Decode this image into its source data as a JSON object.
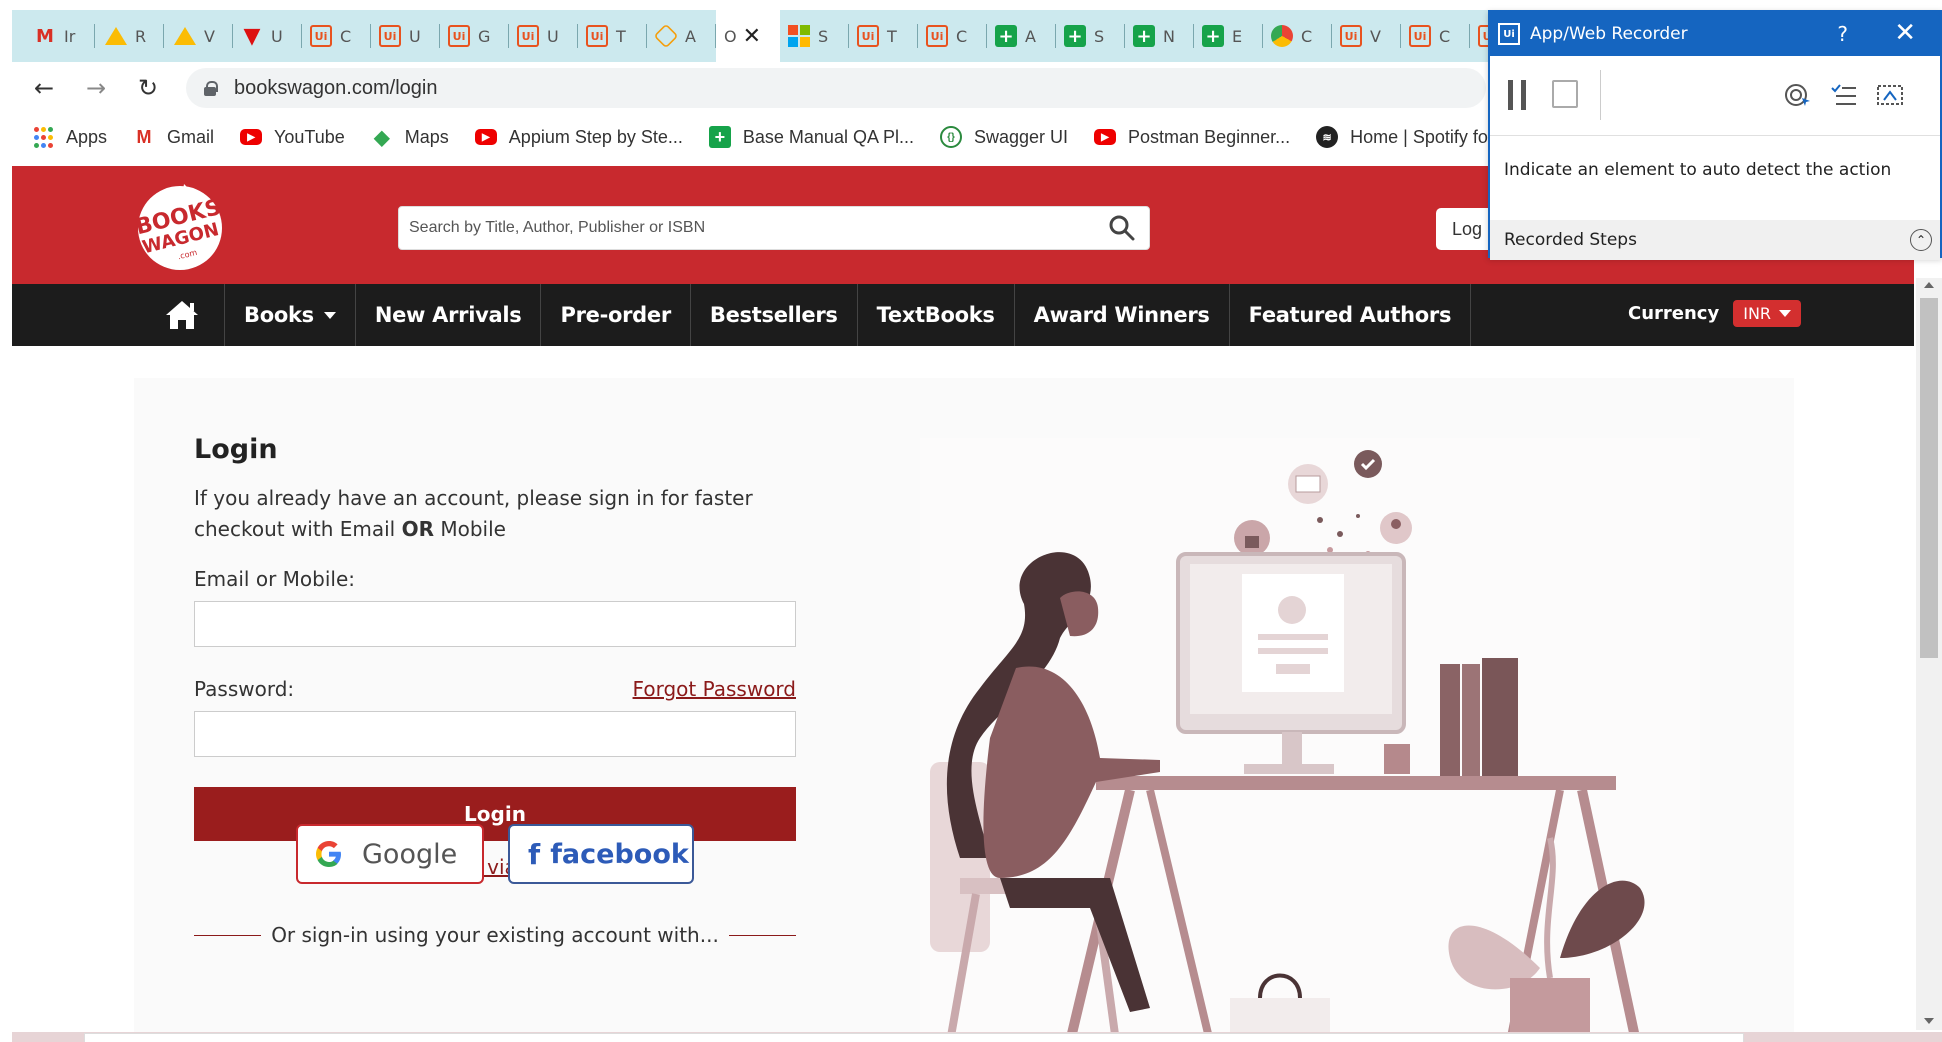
{
  "browser": {
    "tabs": [
      {
        "icon": "gmail-icon",
        "label": "Ir"
      },
      {
        "icon": "google-drive-icon",
        "label": "R"
      },
      {
        "icon": "google-drive-icon",
        "label": "V"
      },
      {
        "icon": "red-v-icon",
        "label": "U"
      },
      {
        "icon": "uipath-icon",
        "label": "C"
      },
      {
        "icon": "uipath-icon",
        "label": "U"
      },
      {
        "icon": "uipath-icon",
        "label": "G"
      },
      {
        "icon": "uipath-icon",
        "label": "U"
      },
      {
        "icon": "uipath-icon",
        "label": "T"
      },
      {
        "icon": "orange-hex-icon",
        "label": "A"
      },
      {
        "icon": "",
        "label": "O",
        "active": true
      },
      {
        "icon": "microsoft-icon",
        "label": "S"
      },
      {
        "icon": "uipath-icon",
        "label": "T"
      },
      {
        "icon": "uipath-icon",
        "label": "C"
      },
      {
        "icon": "google-sheets-icon",
        "label": "A"
      },
      {
        "icon": "google-sheets-icon",
        "label": "S"
      },
      {
        "icon": "google-sheets-icon",
        "label": "N"
      },
      {
        "icon": "google-sheets-icon",
        "label": "E"
      },
      {
        "icon": "chrome-icon",
        "label": "C"
      },
      {
        "icon": "uipath-icon",
        "label": "V"
      },
      {
        "icon": "uipath-icon",
        "label": "C"
      },
      {
        "icon": "uipath-icon",
        "label": ""
      }
    ],
    "url": "bookswagon.com/login",
    "bookmarks": [
      {
        "icon": "apps-icon",
        "label": "Apps"
      },
      {
        "icon": "gmail-icon",
        "label": "Gmail"
      },
      {
        "icon": "youtube-icon",
        "label": "YouTube"
      },
      {
        "icon": "maps-icon",
        "label": "Maps"
      },
      {
        "icon": "youtube-icon",
        "label": "Appium Step by Ste..."
      },
      {
        "icon": "google-sheets-icon",
        "label": "Base Manual QA Pl..."
      },
      {
        "icon": "swagger-icon",
        "label": "Swagger UI"
      },
      {
        "icon": "youtube-icon",
        "label": "Postman Beginner..."
      },
      {
        "icon": "spotify-icon",
        "label": "Home | Spotify for..."
      }
    ]
  },
  "site": {
    "logo_text_1": "BOOKS",
    "logo_text_2": "WAGON",
    "logo_text_3": ".com",
    "search_placeholder": "Search by Title, Author, Publisher or ISBN",
    "login_pill": "Log",
    "nav": {
      "books": "Books",
      "new_arrivals": "New Arrivals",
      "preorder": "Pre-order",
      "bestsellers": "Bestsellers",
      "textbooks": "TextBooks",
      "award_winners": "Award Winners",
      "featured_authors": "Featured Authors",
      "currency_label": "Currency",
      "currency_value": "INR"
    },
    "login": {
      "title": "Login",
      "intro_1": "If you already have an account, please sign in for faster",
      "intro_2a": "checkout with Email ",
      "intro_2b": "OR",
      "intro_2c": " Mobile",
      "email_label": "Email or Mobile:",
      "email_value": "",
      "password_label": "Password:",
      "forgot": "Forgot Password",
      "password_value": "",
      "button": "Login",
      "otp": "Login via OTP",
      "or_text": "Or sign-in using your existing account with...",
      "google": "Google",
      "facebook": "facebook"
    }
  },
  "recorder": {
    "title": "App/Web Recorder",
    "help": "?",
    "close": "✕",
    "hint": "Indicate an element to auto detect the action",
    "steps_label": "Recorded Steps"
  },
  "colors": {
    "brand_red": "#c8292e",
    "nav_dark": "#1c1c1c",
    "login_button": "#9a1d1d",
    "recorder_blue": "#1565c0"
  }
}
